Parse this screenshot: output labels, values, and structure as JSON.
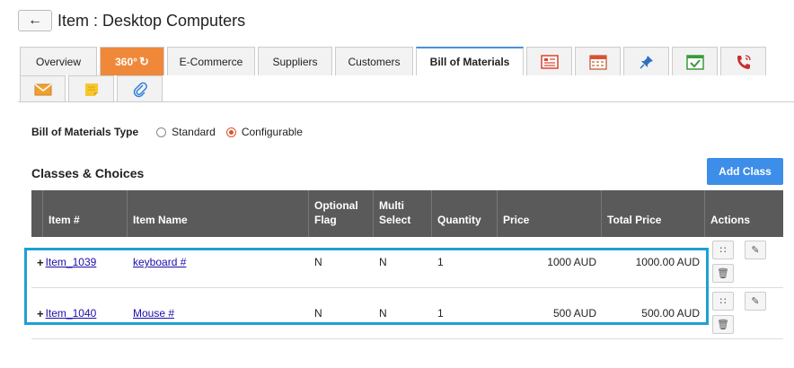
{
  "header": {
    "back_icon": "arrow-left-icon",
    "title": "Item : Desktop Computers"
  },
  "tabs": {
    "row1": [
      {
        "label": "Overview",
        "icon": null
      },
      {
        "label": "360°",
        "icon": "refresh-icon"
      },
      {
        "label": "E-Commerce",
        "icon": null
      },
      {
        "label": "Suppliers",
        "icon": null
      },
      {
        "label": "Customers",
        "icon": null
      },
      {
        "label": "Bill of Materials",
        "icon": null,
        "active": true
      }
    ],
    "icon_tabs_row1": [
      "list-card-icon",
      "calendar-grid-icon",
      "pin-icon",
      "calendar-check-icon",
      "phone-icon"
    ],
    "icon_tabs_row2": [
      "envelope-icon",
      "sticky-note-icon",
      "paperclip-icon"
    ]
  },
  "bom_type": {
    "label": "Bill of Materials Type",
    "options": [
      {
        "label": "Standard",
        "selected": false
      },
      {
        "label": "Configurable",
        "selected": true
      }
    ]
  },
  "section": {
    "title": "Classes & Choices",
    "add_button": "Add Class"
  },
  "table": {
    "headers": {
      "item_no": "Item #",
      "item_name": "Item Name",
      "optional_1": "Optional",
      "optional_2": "Flag",
      "multi_1": "Multi",
      "multi_2": "Select",
      "quantity": "Quantity",
      "price": "Price",
      "total": "Total Price",
      "actions": "Actions"
    },
    "rows": [
      {
        "item_no": "Item_1039",
        "item_name": "keyboard #",
        "optional": "N",
        "multi": "N",
        "quantity": "1",
        "price": "1000 AUD",
        "total": "1000.00 AUD"
      },
      {
        "item_no": "Item_1040",
        "item_name": "Mouse #",
        "optional": "N",
        "multi": "N",
        "quantity": "1",
        "price": "500 AUD",
        "total": "500.00 AUD"
      }
    ]
  },
  "colors": {
    "accent": "#3d8ee8",
    "orange_tab": "#f0883a",
    "highlight": "#1ea0d6",
    "header_bg": "#5a5a5a"
  }
}
